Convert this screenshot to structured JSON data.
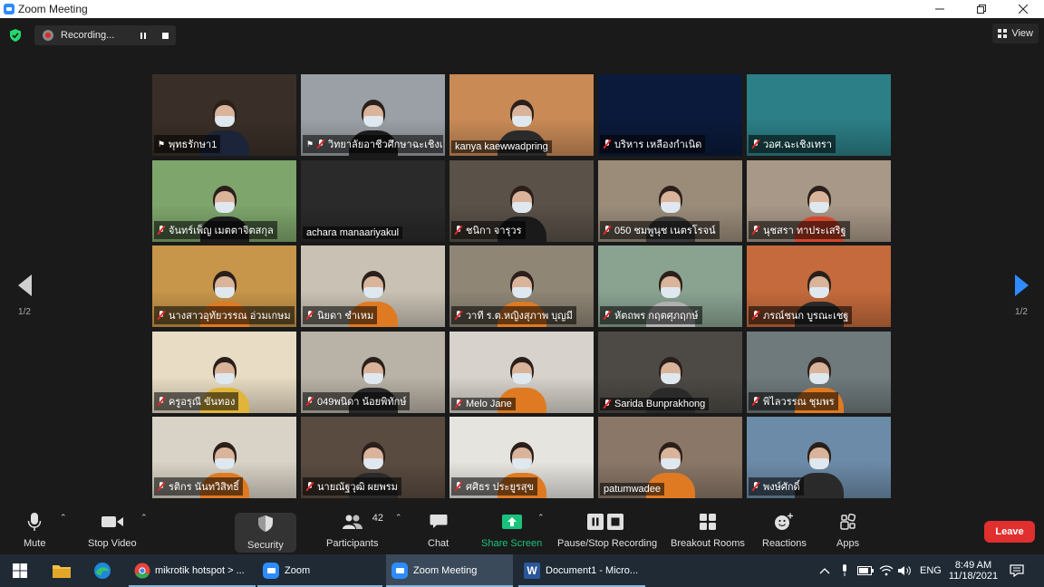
{
  "window": {
    "title": "Zoom Meeting"
  },
  "recording": {
    "label": "Recording..."
  },
  "view": {
    "label": "View"
  },
  "pager": {
    "left": "1/2",
    "right": "1/2"
  },
  "participants": [
    {
      "name": "พุทธรักษา1",
      "muted": false,
      "pinned": true,
      "bg": "#3a2f28",
      "shirt": "#1b2438",
      "active": true
    },
    {
      "name": "วิทยาลัยอาชีวศึกษาฉะเชิงเ...",
      "muted": true,
      "pinned": true,
      "bg": "#9aa0a6",
      "shirt": "#1a1a1a"
    },
    {
      "name": "kanya kaewwadpring",
      "muted": false,
      "pinned": false,
      "bg": "#c98a56",
      "shirt": "#2a2a2a"
    },
    {
      "name": "บริหาร เหลืองกำเนิด",
      "muted": true,
      "pinned": false,
      "bg": "#0b1a3a",
      "shirt": ""
    },
    {
      "name": "วอศ.ฉะเชิงเทรา",
      "muted": true,
      "pinned": false,
      "bg": "#2c7f86",
      "shirt": ""
    },
    {
      "name": "จันทร์เพ็ญ เมตตาจิตสกุล",
      "muted": true,
      "pinned": false,
      "bg": "#7ea56c",
      "shirt": "#1c1c1c"
    },
    {
      "name": "achara manaariyakul",
      "muted": false,
      "pinned": false,
      "bg": "#2a2a2a",
      "shirt": ""
    },
    {
      "name": "ชนิกา จารุวร",
      "muted": true,
      "pinned": false,
      "bg": "#5a5148",
      "shirt": "#1a1a1a"
    },
    {
      "name": "050 ชมพูนุช เนตรโรจน์",
      "muted": true,
      "pinned": false,
      "bg": "#9b8c7a",
      "shirt": "#3a3a3a"
    },
    {
      "name": "นุชสรา ทาประเสริฐ",
      "muted": true,
      "pinned": false,
      "bg": "#a89888",
      "shirt": "#d4462c"
    },
    {
      "name": "นางสาวอุทัยวรรณ อ่วมเกษม",
      "muted": true,
      "pinned": false,
      "bg": "#c7964a",
      "shirt": "#e07a22"
    },
    {
      "name": "นิยดา ชำเหม",
      "muted": true,
      "pinned": false,
      "bg": "#c9c2b4",
      "shirt": "#e07a22"
    },
    {
      "name": "วาที ร.ต.หญิงสุภาพ บุญมี",
      "muted": true,
      "pinned": false,
      "bg": "#8f8675",
      "shirt": "#e07a22"
    },
    {
      "name": "หัตถพร กฤตศุภฤกษ์",
      "muted": true,
      "pinned": false,
      "bg": "#8aa391",
      "shirt": "#b0b0b0"
    },
    {
      "name": "ภรณ์ชนก บูรณะเชฐ",
      "muted": true,
      "pinned": false,
      "bg": "#c46a3c",
      "shirt": "#2a2a2a"
    },
    {
      "name": "ครูอรุณี ขันทอง",
      "muted": true,
      "pinned": false,
      "bg": "#e8dcc4",
      "shirt": "#e0b53a"
    },
    {
      "name": "049พนิดา น้อยพิทักษ์",
      "muted": true,
      "pinned": false,
      "bg": "#b9b2a6",
      "shirt": "#2a2a2a"
    },
    {
      "name": "Melo Jane",
      "muted": true,
      "pinned": false,
      "bg": "#d7d2cb",
      "shirt": "#e07a22"
    },
    {
      "name": "Sarida Bunprakhong",
      "muted": true,
      "pinned": false,
      "bg": "#4d4a45",
      "shirt": "#2a2a2a"
    },
    {
      "name": "พิไลวรรณ ชุมพร",
      "muted": true,
      "pinned": false,
      "bg": "#6f7a7c",
      "shirt": "#e07a22"
    },
    {
      "name": "รติกร นันทวิสิทธิ์",
      "muted": true,
      "pinned": false,
      "bg": "#d9d2c6",
      "shirt": "#e07a22"
    },
    {
      "name": "นายณัฐวุฒิ ผยพรม",
      "muted": true,
      "pinned": false,
      "bg": "#5a4b40",
      "shirt": "#2a2a2a"
    },
    {
      "name": "ศศิธร ประยูรสุข",
      "muted": true,
      "pinned": false,
      "bg": "#e6e4df",
      "shirt": "#e07a22"
    },
    {
      "name": "patumwadee",
      "muted": false,
      "pinned": false,
      "bg": "#8a7768",
      "shirt": "#e07a22"
    },
    {
      "name": "พงษ์ศักดิ์",
      "muted": true,
      "pinned": false,
      "bg": "#6c8ba8",
      "shirt": "#2a2a2a"
    }
  ],
  "toolbar": {
    "mute": "Mute",
    "stop_video": "Stop Video",
    "security": "Security",
    "participants": "Participants",
    "participants_count": "42",
    "chat": "Chat",
    "share_screen": "Share Screen",
    "pause_stop_recording": "Pause/Stop Recording",
    "breakout_rooms": "Breakout Rooms",
    "reactions": "Reactions",
    "apps": "Apps",
    "leave": "Leave"
  },
  "taskbar": {
    "items": [
      "mikrotik hotspot > ...",
      "Zoom",
      "Zoom Meeting",
      "Document1 - Micro..."
    ],
    "language": "ENG",
    "time": "8:49 AM",
    "date": "11/18/2021"
  },
  "colors": {
    "accent": "#2d8cff",
    "active_speaker": "#c7e13f",
    "leave": "#e02f2f",
    "share": "#19c37d"
  }
}
